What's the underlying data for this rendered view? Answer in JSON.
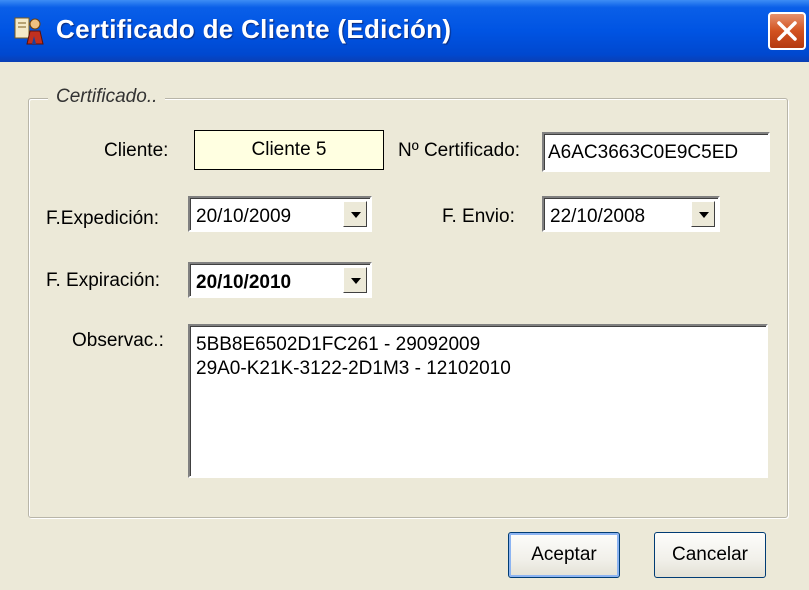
{
  "window": {
    "title": "Certificado de Cliente (Edición)",
    "icon": "certificate-person-icon",
    "close_icon": "close-icon"
  },
  "group": {
    "label": "Certificado.."
  },
  "fields": {
    "cliente_label": "Cliente:",
    "cliente_value": "Cliente 5",
    "certificado_label": "Nº Certificado:",
    "certificado_value": "A6AC3663C0E9C5ED",
    "expedicion_label": "F.Expedición:",
    "expedicion_value": "20/10/2009",
    "envio_label": "F. Envio:",
    "envio_value": "22/10/2008",
    "expiracion_label": "F. Expiración:",
    "expiracion_value": "20/10/2010",
    "observaciones_label": "Observac.:",
    "observaciones_lines": [
      "5BB8E6502D1FC261 - 29092009",
      "29A0-K21K-3122-2D1M3 - 12102010"
    ]
  },
  "buttons": {
    "accept": "Aceptar",
    "cancel": "Cancelar"
  },
  "colors": {
    "titlebar": "#0054e3",
    "close": "#d2521f",
    "client_bg": "#ffffe1",
    "face": "#ece9d8"
  }
}
